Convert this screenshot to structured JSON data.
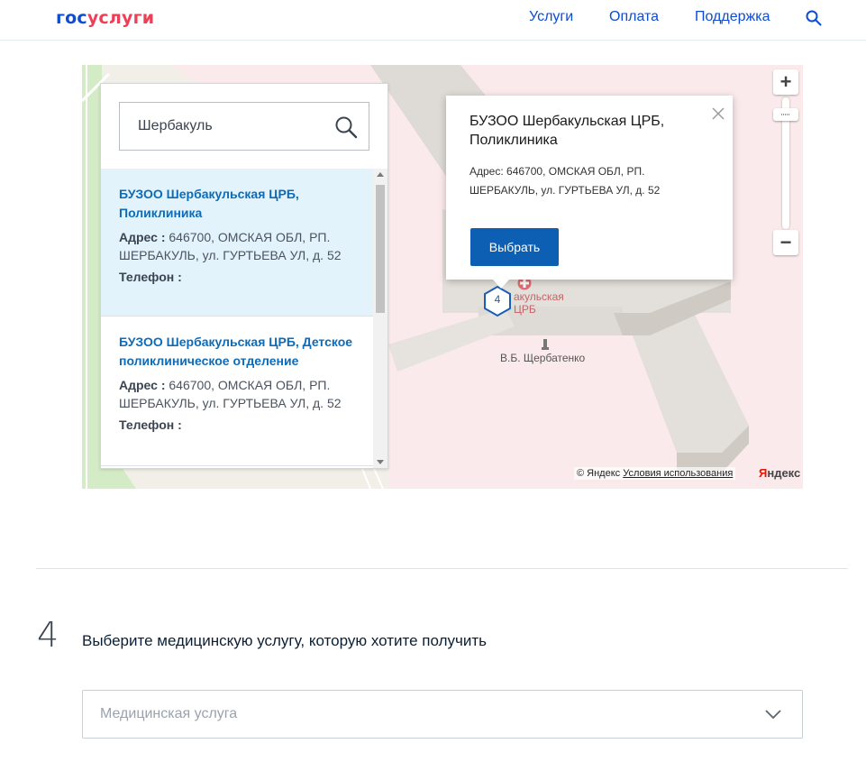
{
  "header": {
    "logo_part1": "гос",
    "logo_part2": "услуги",
    "nav": {
      "services": "Услуги",
      "payment": "Оплата",
      "support": "Поддержка"
    },
    "search_icon": "search-icon"
  },
  "map": {
    "search": {
      "value": "Шербакуль",
      "icon": "search-icon"
    },
    "results": [
      {
        "title": "БУЗОО Шербакульская ЦРБ, Поликлиника",
        "address_label": "Адрес :",
        "address": "646700, ОМСКАЯ ОБЛ, РП. ШЕРБАКУЛЬ, ул. ГУРТЬЕВА УЛ, д. 52",
        "phone_label": "Телефон :",
        "selected": true
      },
      {
        "title": "БУЗОО Шербакульская ЦРБ, Детское поликлиническое отделение",
        "address_label": "Адрес :",
        "address": "646700, ОМСКАЯ ОБЛ, РП. ШЕРБАКУЛЬ, ул. ГУРТЬЕВА УЛ, д. 52",
        "phone_label": "Телефон :",
        "selected": false
      }
    ],
    "balloon": {
      "title": "БУЗОО Шербакульская ЦРБ, Поликлиника",
      "address": "Адрес: 646700, ОМСКАЯ ОБЛ, РП. ШЕРБАКУЛЬ, ул. ГУРТЬЕВА УЛ, д. 52",
      "button": "Выбрать"
    },
    "marker_count": "4",
    "labels": {
      "hospital_line1": "акульская",
      "hospital_line2": "ЦРБ",
      "monument": "В.Б. Щербатенко"
    },
    "zoom": {
      "in": "+",
      "out": "−"
    },
    "copyright": "© Яндекс",
    "terms": "Условия использования",
    "provider_logo_first": "Я",
    "provider_logo_rest": "ндекс"
  },
  "step": {
    "number": "4",
    "title": "Выберите медицинскую услугу, которую хотите получить",
    "select_placeholder": "Медицинская услуга"
  }
}
